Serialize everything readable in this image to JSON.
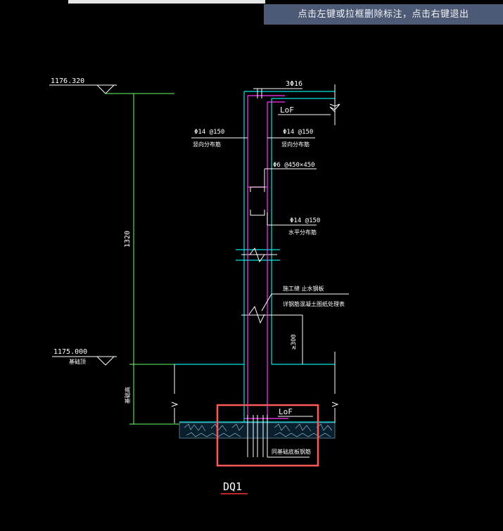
{
  "toolbar": {
    "hint_text": "点击左键或拉框删除标注，点击右键退出"
  },
  "drawing": {
    "elevation_top": "1176.320",
    "elevation_bottom": "1175.000",
    "bottom_elev_label": "基础顶",
    "dimension_height": "1320",
    "dimension_300": "≥300",
    "side_dim_label": "基础高",
    "top_rebar": "3Φ16",
    "lof_top": "LoF",
    "left_vertical_rebar": "Φ14 @150",
    "left_vertical_label": "竖向分布筋",
    "right_vertical_rebar": "Φ14 @150",
    "right_vertical_label": "竖向分布筋",
    "tie_rebar": "Φ6 @450×450",
    "horizontal_rebar": "Φ14 @150",
    "horizontal_label": "水平分布筋",
    "joint_note_1": "施工缝  止水钢板",
    "joint_note_2": "详钢筋混凝土图纸处理表",
    "lof_bottom": "LoF",
    "base_note": "同基础底板钢筋",
    "title": "DQ1"
  },
  "colors": {
    "cyan": "#00e5e5",
    "green": "#66ff66",
    "magenta": "#ff33ff",
    "highlight": "#ff5a5a",
    "hint_bg": "#4d5a75"
  }
}
